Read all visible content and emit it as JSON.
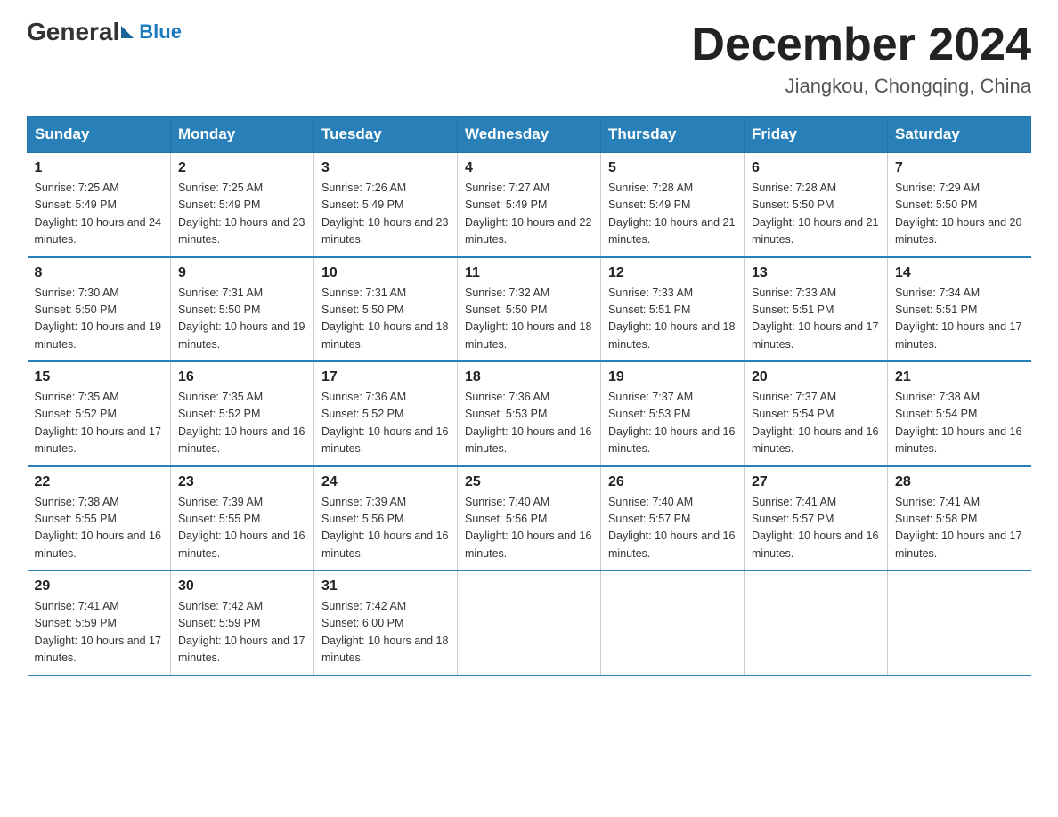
{
  "header": {
    "logo_general": "General",
    "logo_blue": "Blue",
    "month_title": "December 2024",
    "location": "Jiangkou, Chongqing, China"
  },
  "days_of_week": [
    "Sunday",
    "Monday",
    "Tuesday",
    "Wednesday",
    "Thursday",
    "Friday",
    "Saturday"
  ],
  "weeks": [
    [
      {
        "day": "1",
        "sunrise": "7:25 AM",
        "sunset": "5:49 PM",
        "daylight": "10 hours and 24 minutes."
      },
      {
        "day": "2",
        "sunrise": "7:25 AM",
        "sunset": "5:49 PM",
        "daylight": "10 hours and 23 minutes."
      },
      {
        "day": "3",
        "sunrise": "7:26 AM",
        "sunset": "5:49 PM",
        "daylight": "10 hours and 23 minutes."
      },
      {
        "day": "4",
        "sunrise": "7:27 AM",
        "sunset": "5:49 PM",
        "daylight": "10 hours and 22 minutes."
      },
      {
        "day": "5",
        "sunrise": "7:28 AM",
        "sunset": "5:49 PM",
        "daylight": "10 hours and 21 minutes."
      },
      {
        "day": "6",
        "sunrise": "7:28 AM",
        "sunset": "5:50 PM",
        "daylight": "10 hours and 21 minutes."
      },
      {
        "day": "7",
        "sunrise": "7:29 AM",
        "sunset": "5:50 PM",
        "daylight": "10 hours and 20 minutes."
      }
    ],
    [
      {
        "day": "8",
        "sunrise": "7:30 AM",
        "sunset": "5:50 PM",
        "daylight": "10 hours and 19 minutes."
      },
      {
        "day": "9",
        "sunrise": "7:31 AM",
        "sunset": "5:50 PM",
        "daylight": "10 hours and 19 minutes."
      },
      {
        "day": "10",
        "sunrise": "7:31 AM",
        "sunset": "5:50 PM",
        "daylight": "10 hours and 18 minutes."
      },
      {
        "day": "11",
        "sunrise": "7:32 AM",
        "sunset": "5:50 PM",
        "daylight": "10 hours and 18 minutes."
      },
      {
        "day": "12",
        "sunrise": "7:33 AM",
        "sunset": "5:51 PM",
        "daylight": "10 hours and 18 minutes."
      },
      {
        "day": "13",
        "sunrise": "7:33 AM",
        "sunset": "5:51 PM",
        "daylight": "10 hours and 17 minutes."
      },
      {
        "day": "14",
        "sunrise": "7:34 AM",
        "sunset": "5:51 PM",
        "daylight": "10 hours and 17 minutes."
      }
    ],
    [
      {
        "day": "15",
        "sunrise": "7:35 AM",
        "sunset": "5:52 PM",
        "daylight": "10 hours and 17 minutes."
      },
      {
        "day": "16",
        "sunrise": "7:35 AM",
        "sunset": "5:52 PM",
        "daylight": "10 hours and 16 minutes."
      },
      {
        "day": "17",
        "sunrise": "7:36 AM",
        "sunset": "5:52 PM",
        "daylight": "10 hours and 16 minutes."
      },
      {
        "day": "18",
        "sunrise": "7:36 AM",
        "sunset": "5:53 PM",
        "daylight": "10 hours and 16 minutes."
      },
      {
        "day": "19",
        "sunrise": "7:37 AM",
        "sunset": "5:53 PM",
        "daylight": "10 hours and 16 minutes."
      },
      {
        "day": "20",
        "sunrise": "7:37 AM",
        "sunset": "5:54 PM",
        "daylight": "10 hours and 16 minutes."
      },
      {
        "day": "21",
        "sunrise": "7:38 AM",
        "sunset": "5:54 PM",
        "daylight": "10 hours and 16 minutes."
      }
    ],
    [
      {
        "day": "22",
        "sunrise": "7:38 AM",
        "sunset": "5:55 PM",
        "daylight": "10 hours and 16 minutes."
      },
      {
        "day": "23",
        "sunrise": "7:39 AM",
        "sunset": "5:55 PM",
        "daylight": "10 hours and 16 minutes."
      },
      {
        "day": "24",
        "sunrise": "7:39 AM",
        "sunset": "5:56 PM",
        "daylight": "10 hours and 16 minutes."
      },
      {
        "day": "25",
        "sunrise": "7:40 AM",
        "sunset": "5:56 PM",
        "daylight": "10 hours and 16 minutes."
      },
      {
        "day": "26",
        "sunrise": "7:40 AM",
        "sunset": "5:57 PM",
        "daylight": "10 hours and 16 minutes."
      },
      {
        "day": "27",
        "sunrise": "7:41 AM",
        "sunset": "5:57 PM",
        "daylight": "10 hours and 16 minutes."
      },
      {
        "day": "28",
        "sunrise": "7:41 AM",
        "sunset": "5:58 PM",
        "daylight": "10 hours and 17 minutes."
      }
    ],
    [
      {
        "day": "29",
        "sunrise": "7:41 AM",
        "sunset": "5:59 PM",
        "daylight": "10 hours and 17 minutes."
      },
      {
        "day": "30",
        "sunrise": "7:42 AM",
        "sunset": "5:59 PM",
        "daylight": "10 hours and 17 minutes."
      },
      {
        "day": "31",
        "sunrise": "7:42 AM",
        "sunset": "6:00 PM",
        "daylight": "10 hours and 18 minutes."
      },
      null,
      null,
      null,
      null
    ]
  ]
}
